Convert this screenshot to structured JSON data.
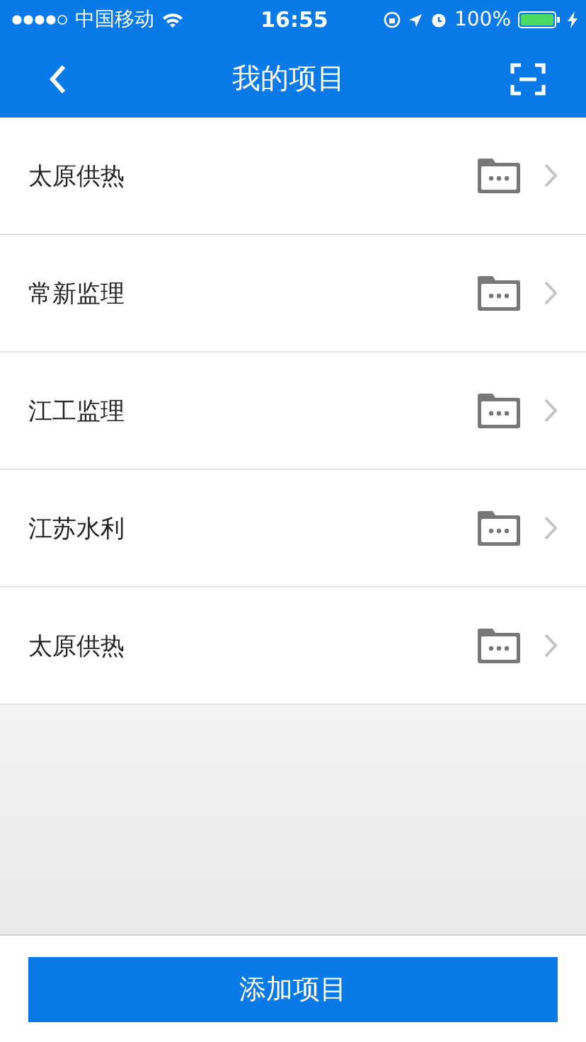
{
  "status_bar": {
    "carrier": "中国移动",
    "time": "16:55",
    "battery": "100%"
  },
  "nav": {
    "title": "我的项目"
  },
  "projects": [
    {
      "name": "太原供热"
    },
    {
      "name": "常新监理"
    },
    {
      "name": "江工监理"
    },
    {
      "name": "江苏水利"
    },
    {
      "name": "太原供热"
    }
  ],
  "footer": {
    "button": "添加项目"
  }
}
